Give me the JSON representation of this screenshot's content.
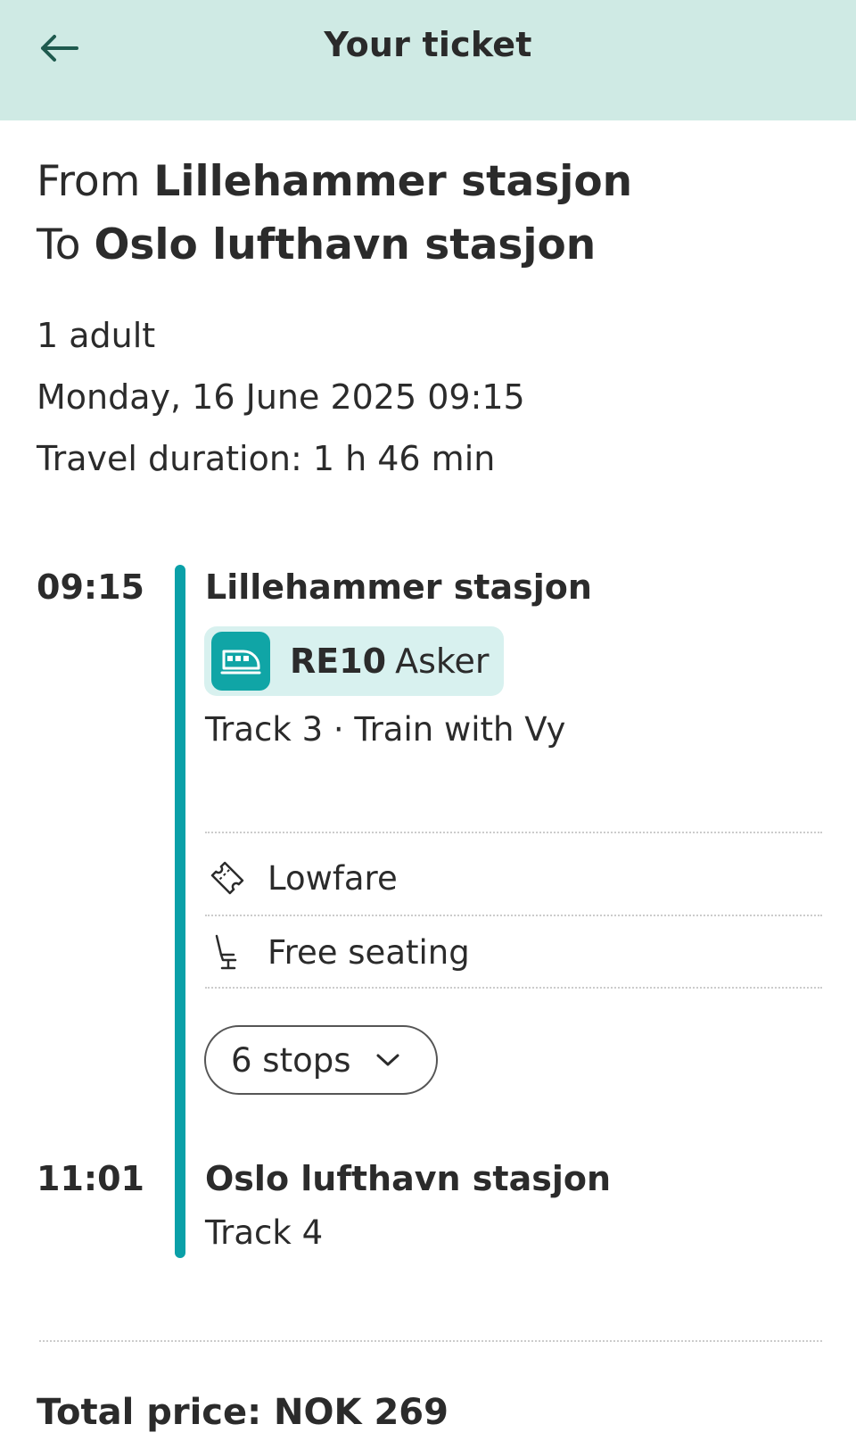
{
  "header": {
    "title": "Your ticket"
  },
  "route": {
    "from_label": "From",
    "from_station": "Lillehammer stasjon",
    "to_label": "To",
    "to_station": "Oslo lufthavn stasjon"
  },
  "info": {
    "passengers": "1 adult",
    "date_time": "Monday, 16 June 2025 09:15",
    "duration": "Travel duration: 1 h 46 min"
  },
  "departure": {
    "time": "09:15",
    "station": "Lillehammer stasjon",
    "line_code": "RE10",
    "line_destination": "Asker",
    "details": "Track 3 · Train with Vy"
  },
  "features": [
    {
      "label": "Lowfare",
      "icon": "ticket-icon"
    },
    {
      "label": "Free seating",
      "icon": "seat-icon"
    }
  ],
  "stops_button": {
    "label": "6 stops"
  },
  "arrival": {
    "time": "11:01",
    "station": "Oslo lufthavn stasjon",
    "track": "Track 4"
  },
  "total": {
    "label": "Total price: NOK 269"
  },
  "colors": {
    "header_bg": "#cfeae4",
    "accent": "#0aa0a8",
    "chip_bg": "#d8f1ef"
  }
}
